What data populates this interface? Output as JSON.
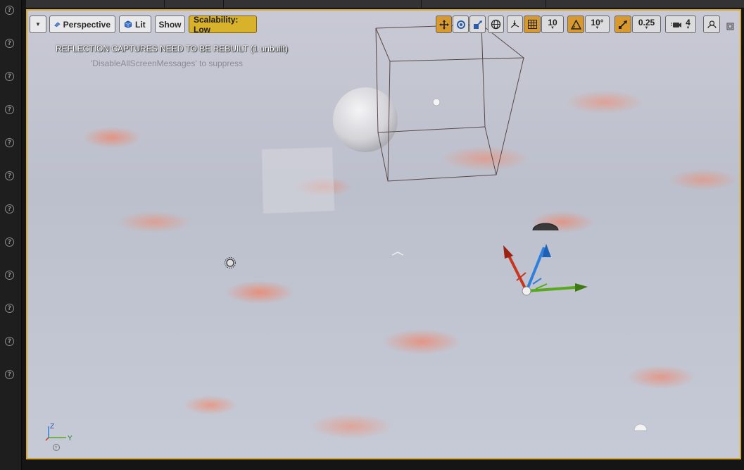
{
  "toolbar": {
    "view_mode": "Perspective",
    "lighting_mode": "Lit",
    "show_label": "Show",
    "scalability_label": "Scalability: Low",
    "grid_snap_value": "10",
    "rotation_snap_value": "10°",
    "scale_snap_value": "0.25",
    "camera_speed_value": "4"
  },
  "messages": {
    "warning": "REFLECTION CAPTURES NEED TO BE REBUILT (1 unbuilt)",
    "suppress_hint": "'DisableAllScreenMessages' to suppress"
  },
  "axis_indicator": {
    "z": "Z",
    "y": "Y"
  },
  "colors": {
    "viewport_border": "#d8a72a",
    "scalability_button": "#d9b22c",
    "gizmo_x": "#c8361f",
    "gizmo_y": "#5aa81e",
    "gizmo_z": "#2f7fdc"
  },
  "icons": {
    "left_strip": "help-icon",
    "toolbar_menu": "chevron-down-icon",
    "perspective": "perspective-icon",
    "lit": "lit-cube-icon",
    "translate": "translate-icon",
    "rotate": "rotate-icon",
    "scale": "scale-icon",
    "world": "world-icon",
    "surface_snap": "surface-snap-icon",
    "grid": "grid-icon",
    "rotation_snap": "rotation-snap-icon",
    "scale_snap": "scale-snap-icon",
    "camera_speed": "camera-speed-icon",
    "maximize": "maximize-icon",
    "restore": "restore-icon"
  }
}
